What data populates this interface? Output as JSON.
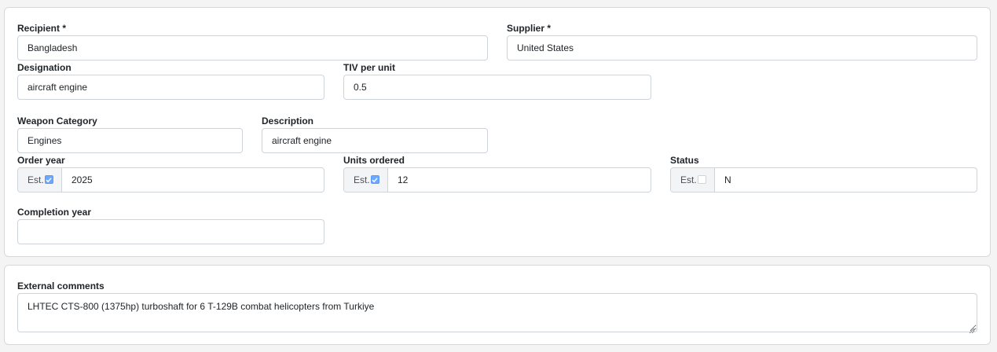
{
  "form": {
    "recipient": {
      "label": "Recipient *",
      "value": "Bangladesh"
    },
    "supplier": {
      "label": "Supplier *",
      "value": "United States"
    },
    "designation": {
      "label": "Designation",
      "value": "aircraft engine"
    },
    "tiv_per_unit": {
      "label": "TIV per unit",
      "value": "0.5"
    },
    "weapon_category": {
      "label": "Weapon Category",
      "value": "Engines"
    },
    "description": {
      "label": "Description",
      "value": "aircraft engine"
    },
    "order_year": {
      "label": "Order year",
      "est_label": "Est.",
      "est_checked": true,
      "value": "2025"
    },
    "units_ordered": {
      "label": "Units ordered",
      "est_label": "Est.",
      "est_checked": true,
      "value": "12"
    },
    "status": {
      "label": "Status",
      "est_label": "Est.",
      "est_checked": false,
      "value": "N"
    },
    "completion_year": {
      "label": "Completion year",
      "value": ""
    }
  },
  "comments": {
    "label": "External comments",
    "value": "LHTEC CTS-800 (1375hp) turboshaft for 6 T-129B combat helicopters from Turkiye"
  },
  "colors": {
    "checkbox_checked": "#6ea8fe",
    "border": "#ced4da",
    "page_bg": "#f4f4f4"
  }
}
